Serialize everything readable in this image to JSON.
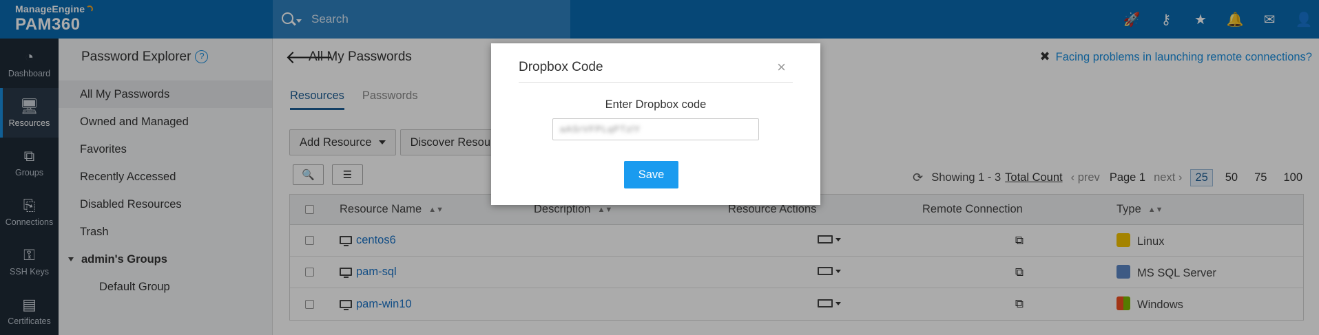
{
  "header": {
    "brand_top": "ManageEngine",
    "brand_product": "PAM360",
    "search_placeholder": "Search",
    "icons": [
      "rocket-icon",
      "key-link-icon",
      "badge-icon",
      "bell-icon",
      "mail-icon",
      "user-icon"
    ]
  },
  "leftnav": {
    "items": [
      {
        "label": "Dashboard",
        "icon": "dashboard-icon",
        "glyph": "◔"
      },
      {
        "label": "Resources",
        "icon": "monitor-icon",
        "glyph": "🖥"
      },
      {
        "label": "Groups",
        "icon": "groups-icon",
        "glyph": "⧉"
      },
      {
        "label": "Connections",
        "icon": "connections-icon",
        "glyph": "⎘"
      },
      {
        "label": "SSH Keys",
        "icon": "ssh-key-icon",
        "glyph": "⚿"
      },
      {
        "label": "Certificates",
        "icon": "certificate-icon",
        "glyph": "▤"
      }
    ]
  },
  "explorer": {
    "title": "Password Explorer",
    "help": "?",
    "items": [
      "All My Passwords",
      "Owned and Managed",
      "Favorites",
      "Recently Accessed",
      "Disabled Resources",
      "Trash"
    ],
    "group_label": "admin's Groups",
    "group_items": [
      "Default Group"
    ]
  },
  "main": {
    "title": "All My Passwords",
    "facing_link": "Facing problems in launching remote connections?",
    "tabs": [
      "Resources",
      "Passwords"
    ],
    "buttons": {
      "add_resource": "Add Resource",
      "discover": "Discover Resources"
    },
    "pager": {
      "showing": "Showing 1 - 3",
      "total": "Total Count",
      "prev": "‹ prev",
      "page": "Page 1",
      "next": "next ›",
      "sizes": [
        "25",
        "50",
        "75",
        "100"
      ],
      "active_size": "25"
    },
    "table": {
      "headers": [
        "Resource Name",
        "Description",
        "Resource Actions",
        "Remote Connection",
        "Type"
      ],
      "rows": [
        {
          "name": "centos6",
          "type": "Linux",
          "os_color": "#f5c400"
        },
        {
          "name": "pam-sql",
          "type": "MS SQL Server",
          "os_color": "#5b87c5"
        },
        {
          "name": "pam-win10",
          "type": "Windows",
          "os_color": "#f25022"
        }
      ]
    }
  },
  "modal": {
    "title": "Dropbox Code",
    "close": "×",
    "label": "Enter Dropbox code",
    "input_value": "aASrVFPLqPTzlY",
    "save_label": "Save"
  },
  "colors": {
    "header_bg": "#0a6ab0",
    "nav_bg": "#1f2a36",
    "link": "#1a73c7",
    "save_button": "#1a9bef"
  }
}
